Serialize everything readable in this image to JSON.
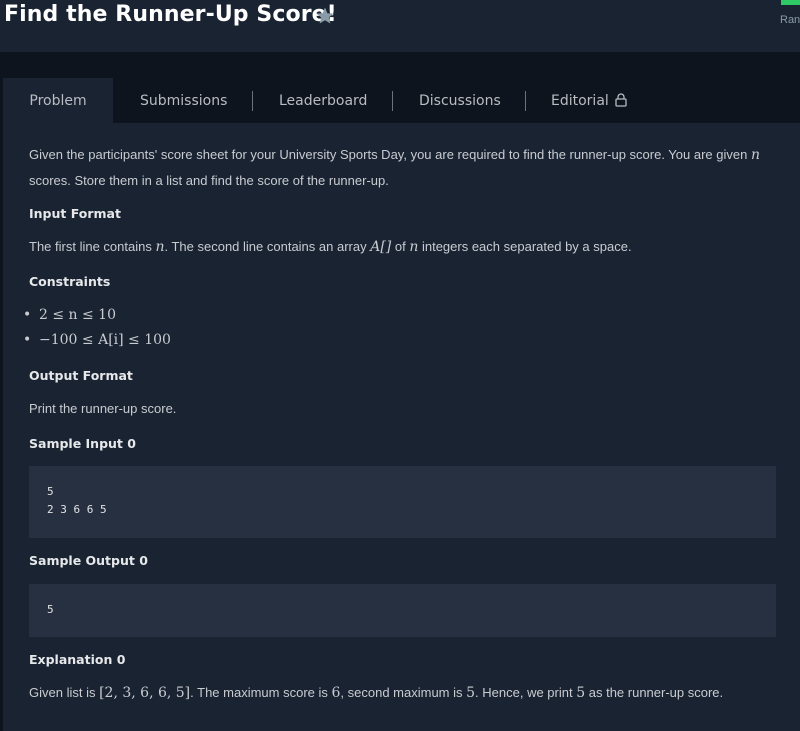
{
  "header": {
    "title": "Find the Runner-Up Score!",
    "rank_label": "Ran"
  },
  "tabs": [
    {
      "label": "Problem",
      "active": true
    },
    {
      "label": "Submissions"
    },
    {
      "label": "Leaderboard"
    },
    {
      "label": "Discussions"
    },
    {
      "label": "Editorial"
    }
  ],
  "problem": {
    "intro_a": "Given the participants' score sheet for your University Sports Day, you are required to find the runner-up score. You are given ",
    "intro_n": "n",
    "intro_b": "scores. Store them in a list and find the score of the runner-up.",
    "input_heading": "Input Format",
    "input_a": "The first line contains ",
    "input_n": "n",
    "input_b": ". The second line contains an array ",
    "input_arr": "A[]",
    "input_c": " of ",
    "input_n2": "n",
    "input_d": " integers each separated by a space.",
    "constraints_heading": "Constraints",
    "constraints": [
      "2 ≤ n ≤ 10",
      "−100 ≤ A[i] ≤ 100"
    ],
    "output_heading": "Output Format",
    "output_text": "Print the runner-up score.",
    "sample_input_heading": "Sample Input 0",
    "sample_input_lines": [
      "5",
      "2 3 6 6 5"
    ],
    "sample_output_heading": "Sample Output 0",
    "sample_output_lines": [
      "5"
    ],
    "explanation_heading": "Explanation 0",
    "expl_a": "Given list is ",
    "expl_list": "[2, 3, 6, 6, 5]",
    "expl_b": ". The maximum score is ",
    "expl_max": "6",
    "expl_c": ", second maximum is ",
    "expl_second": "5",
    "expl_d": ". Hence, we print ",
    "expl_print": "5",
    "expl_e": " as the runner-up score."
  },
  "icons": {
    "star": "star-icon",
    "lock": "lock-icon"
  },
  "colors": {
    "background": "#0e141e",
    "panel": "#1a2332",
    "code_box": "#263040",
    "rank_flag": "#2ec866"
  }
}
